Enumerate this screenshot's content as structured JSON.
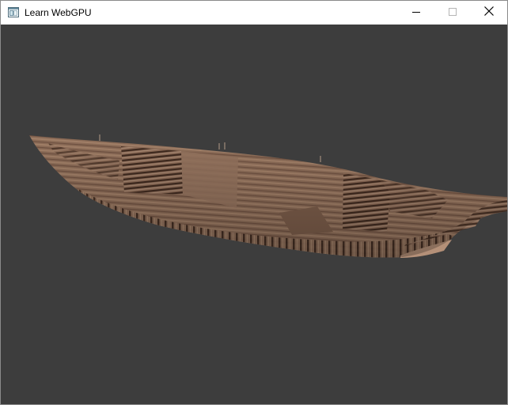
{
  "window": {
    "title": "Learn WebGPU",
    "controls": {
      "minimize": "minimize-icon",
      "maximize": "maximize-icon",
      "close": "close-icon"
    }
  },
  "viewport": {
    "background": "#3d3d3d",
    "object": "wooden-boat-model",
    "colors": {
      "wood_base": "#8d6d58",
      "wood_light": "#a7876f",
      "wood_dark": "#4a3124",
      "hull_shadow": "#6b4e3d"
    }
  }
}
